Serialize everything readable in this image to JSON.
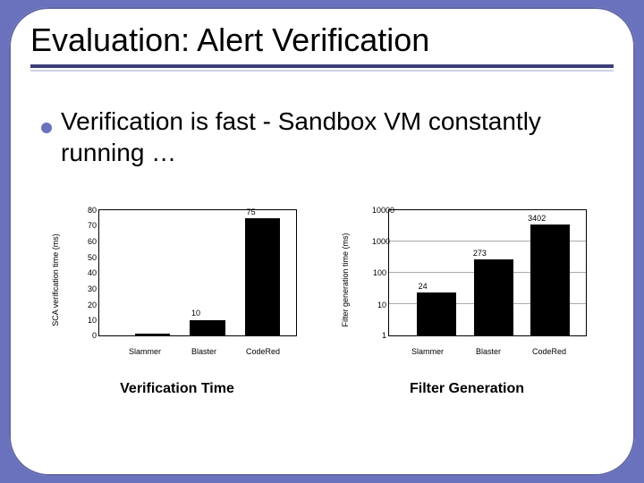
{
  "slide": {
    "title": "Evaluation: Alert Verification",
    "bullet": "Verification is fast - Sandbox VM constantly running …"
  },
  "captions": {
    "left": "Verification Time",
    "right": "Filter Generation"
  },
  "chart_data": [
    {
      "type": "bar",
      "title": "",
      "xlabel": "",
      "ylabel": "SCA verification time (ms)",
      "categories": [
        "Slammer",
        "Blaster",
        "CodeRed"
      ],
      "values": [
        1,
        10,
        75
      ],
      "data_labels": [
        "",
        "10",
        "75"
      ],
      "yticks": [
        0,
        10,
        20,
        30,
        40,
        50,
        60,
        70,
        80
      ],
      "ylim": [
        0,
        80
      ],
      "yscale": "linear"
    },
    {
      "type": "bar",
      "title": "",
      "xlabel": "",
      "ylabel": "Filter generation time (ms)",
      "categories": [
        "Slammer",
        "Blaster",
        "CodeRed"
      ],
      "values": [
        24,
        273,
        3402
      ],
      "data_labels": [
        "24",
        "273",
        "3402"
      ],
      "yticks": [
        1,
        10,
        100,
        1000,
        10000
      ],
      "ylim": [
        1,
        10000
      ],
      "yscale": "log"
    }
  ]
}
